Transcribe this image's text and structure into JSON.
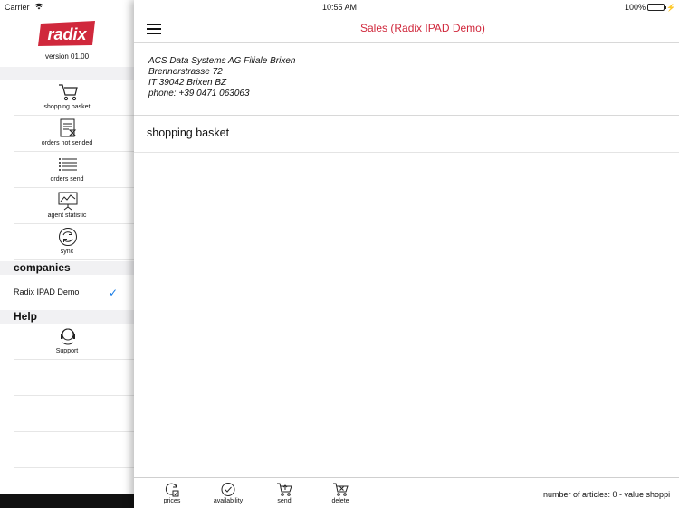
{
  "status_bar": {
    "carrier": "Carrier",
    "time": "10:55 AM",
    "battery": "100%"
  },
  "sidebar": {
    "logo_text": "radix",
    "version": "version 01.00",
    "menu": [
      {
        "label": "shopping basket",
        "icon": "shopping-cart-icon"
      },
      {
        "label": "orders not sended",
        "icon": "pending-orders-icon"
      },
      {
        "label": "orders send",
        "icon": "list-icon"
      },
      {
        "label": "agent statistic",
        "icon": "statistics-chart-icon"
      },
      {
        "label": "sync",
        "icon": "sync-icon"
      }
    ],
    "companies_header": "companies",
    "company": {
      "name": "Radix IPAD Demo",
      "selected": true
    },
    "help_header": "Help",
    "support_label": "Support"
  },
  "main": {
    "title": "Sales (Radix IPAD Demo)",
    "address": {
      "line1": "ACS Data Systems AG Filiale Brixen",
      "line2": "Brennerstrasse 72",
      "line3": "IT  39042 Brixen BZ",
      "line4": "phone: +39 0471 063063"
    },
    "section_title": "shopping basket"
  },
  "toolbar": {
    "prices": "prices",
    "availability": "availability",
    "send": "send",
    "delete": "delete",
    "status": "number of articles: 0 - value shoppi"
  },
  "colors": {
    "accent": "#d0283c",
    "check": "#1a7de6",
    "battery": "#4cd964"
  }
}
